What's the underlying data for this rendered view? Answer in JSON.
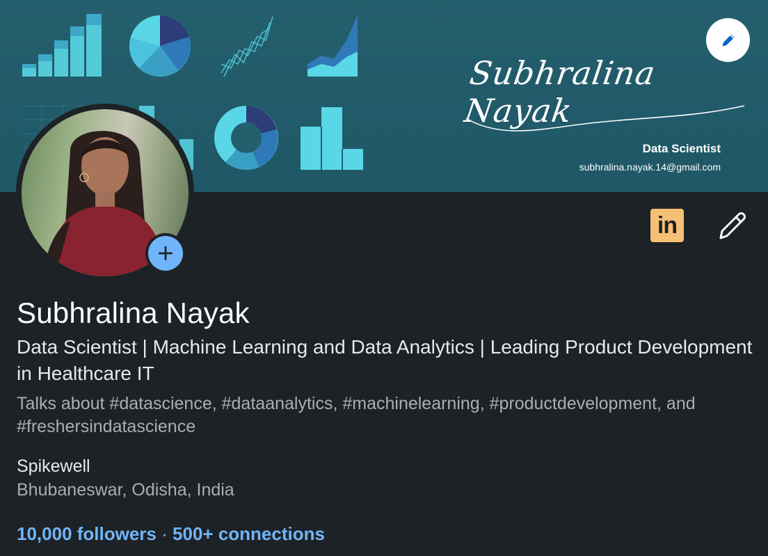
{
  "banner": {
    "signature": "Subhralina Nayak",
    "title": "Data Scientist",
    "email": "subhralina.nayak.14@gmail.com",
    "accent": "#5ad7e6"
  },
  "profile": {
    "name": "Subhralina Nayak",
    "headline": "Data Scientist | Machine Learning and Data Analytics | Leading Product Development in Healthcare IT",
    "talks_about": "Talks about #datascience, #dataanalytics, #machinelearning, #productdevelopment, and #freshersindatascience",
    "company": "Spikewell",
    "location": "Bhubaneswar, Odisha, India"
  },
  "stats": {
    "followers": "10,000 followers",
    "separator": "·",
    "connections": "500+ connections"
  },
  "badges": {
    "linkedin_label": "in"
  },
  "colors": {
    "background": "#1d2226",
    "link": "#70b5f9",
    "linkedin_badge": "#f5c075"
  },
  "icons": {
    "banner_edit": "pencil-icon",
    "profile_edit": "pencil-icon",
    "add_photo": "plus-icon"
  }
}
